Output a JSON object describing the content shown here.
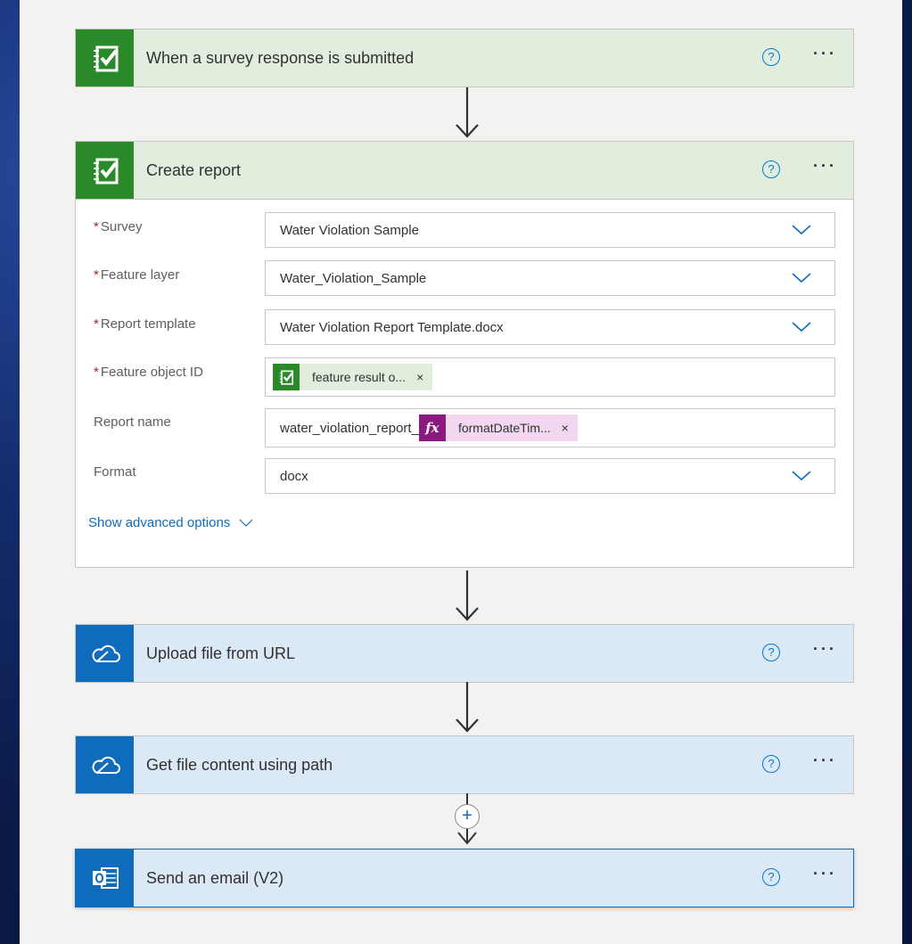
{
  "steps": [
    {
      "title": "When a survey response is submitted",
      "icon": "survey-icon",
      "theme": "#e1eedd"
    },
    {
      "title": "Create report",
      "icon": "survey-icon",
      "theme": "#e1eedd"
    },
    {
      "title": "Upload file from URL",
      "icon": "onedrive-icon",
      "theme": "#dbe8f5"
    },
    {
      "title": "Get file content using path",
      "icon": "onedrive-icon",
      "theme": "#dbe8f5"
    },
    {
      "title": "Send an email (V2)",
      "icon": "outlook-icon",
      "theme": "#dbe8f5"
    }
  ],
  "help_glyph": "?",
  "more_glyph": "···",
  "form": {
    "required_mark": "*",
    "survey": {
      "label": "Survey",
      "value": "Water Violation Sample"
    },
    "feature_layer": {
      "label": "Feature layer",
      "value": "Water_Violation_Sample"
    },
    "report_template": {
      "label": "Report template",
      "value": "Water Violation Report Template.docx"
    },
    "feature_object_id": {
      "label": "Feature object ID",
      "token": "feature result o...",
      "token_remove": "×"
    },
    "report_name": {
      "label": "Report name",
      "prefix": "water_violation_report_",
      "fx_glyph": "fx",
      "token": "formatDateTim...",
      "token_remove": "×"
    },
    "format": {
      "label": "Format",
      "value": "docx"
    },
    "advanced_label": "Show advanced options"
  },
  "add_step_glyph": "+",
  "colors": {
    "survey_green": "#2a8a2a",
    "onedrive_blue": "#0f6cbd",
    "expression_purple": "#8a1a7f",
    "accent": "#0078d4"
  }
}
